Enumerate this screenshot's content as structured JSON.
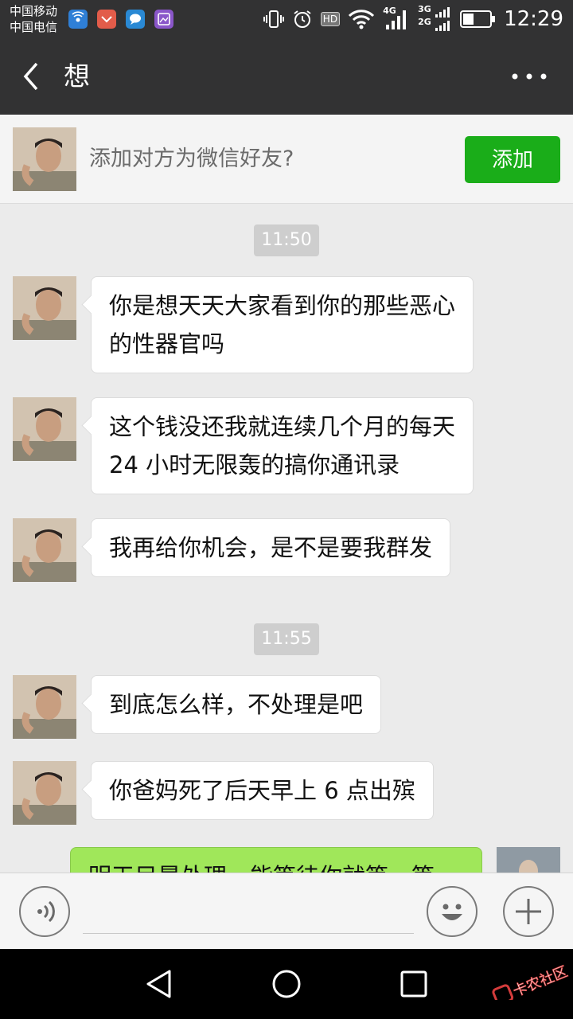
{
  "status_bar": {
    "carrier_1": "中国移动",
    "carrier_2": "中国电信",
    "hd_label": "HD",
    "net_4g": "4G",
    "net_3g": "3G",
    "net_2g": "2G",
    "time": "12:29"
  },
  "title_bar": {
    "title": "想"
  },
  "add_bar": {
    "prompt": "添加对方为微信好友?",
    "button_label": "添加"
  },
  "chat": {
    "timestamps": [
      "11:50",
      "11:55"
    ],
    "messages": [
      {
        "line1": "你是想天天大家看到你的那些恶心",
        "line2": "的性器官吗"
      },
      {
        "line1": "这个钱没还我就连续几个月的每天",
        "line2": "24 小时无限轰的搞你通讯录"
      },
      {
        "line1": "我再给你机会，是不是要我群发"
      },
      {
        "line1": "到底怎么样，不处理是吧"
      },
      {
        "line1": "你爸妈死了后天早上 6 点出殡"
      }
    ],
    "outgoing": {
      "line1": "明天目晨处理，能等待你就等一等"
    }
  },
  "watermark": {
    "text": "卡农社区"
  },
  "colors": {
    "header_bg": "#323233",
    "add_button": "#1aad19",
    "outgoing_bubble": "#a0e75a",
    "chat_bg": "#ebebeb"
  }
}
